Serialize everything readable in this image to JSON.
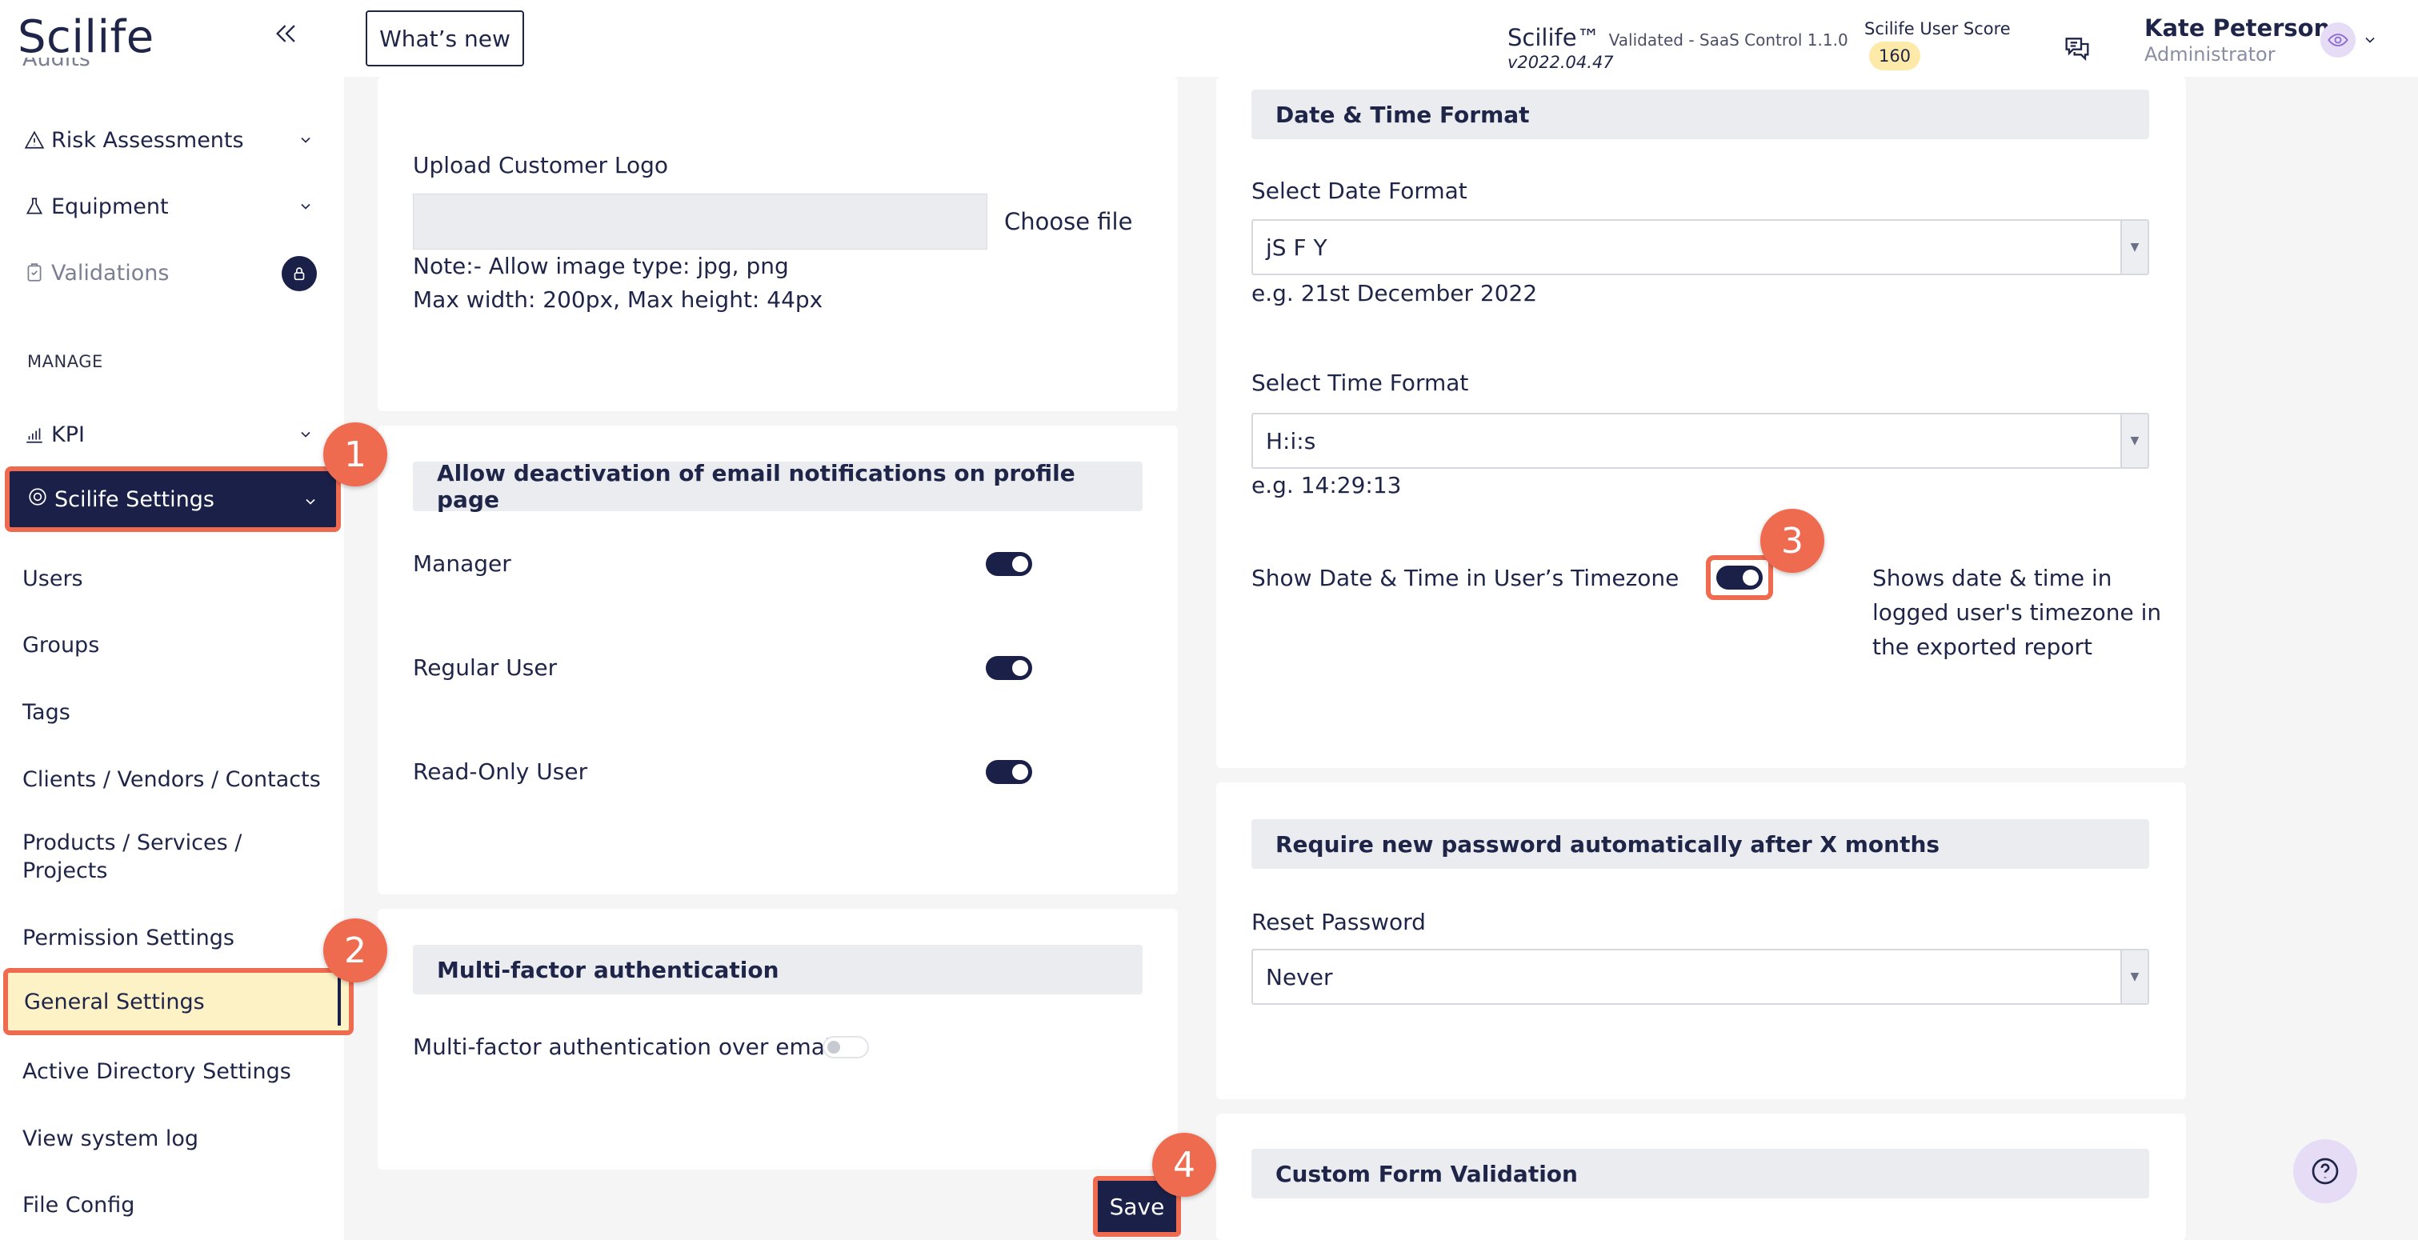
{
  "sidebar": {
    "logo": "Scilife",
    "partial_item": "Audits",
    "items": [
      {
        "label": "Risk Assessments"
      },
      {
        "label": "Equipment"
      },
      {
        "label": "Validations"
      }
    ],
    "section_manage": "MANAGE",
    "kpi": "KPI",
    "settings_group": "Scilife Settings",
    "settings_items": [
      "Users",
      "Groups",
      "Tags",
      "Clients / Vendors / Contacts",
      "Products / Services /",
      "Projects",
      "Permission Settings",
      "General Settings",
      "Active Directory Settings",
      "View system log",
      "File Config"
    ]
  },
  "header": {
    "whats_new": "What’s new",
    "app_name": "Scilife™",
    "app_sub": "Validated - SaaS Control 1.1.0",
    "app_version": "v2022.04.47",
    "score_label": "Scilife User Score",
    "score_value": "160",
    "user_name": "Kate Peterson",
    "user_role": "Administrator"
  },
  "left_col": {
    "upload_label": "Upload Customer Logo",
    "choose_file": "Choose file",
    "note_line1": "Note:- Allow image type: jpg, png",
    "note_line2": "Max width: 200px, Max height: 44px",
    "email_header": "Allow deactivation of email notifications on profile page",
    "email_rows": [
      {
        "label": "Manager",
        "on": true
      },
      {
        "label": "Regular User",
        "on": true
      },
      {
        "label": "Read-Only User",
        "on": true
      }
    ],
    "mfa_header": "Multi-factor authentication",
    "mfa_label": "Multi-factor authentication over email",
    "mfa_on": false
  },
  "right_col": {
    "datetime_header": "Date & Time Format",
    "date_label": "Select Date Format",
    "date_value": "jS F Y",
    "date_example": "e.g. 21st December 2022",
    "time_label": "Select Time Format",
    "time_value": "H:i:s",
    "time_example": "e.g. 14:29:13",
    "tz_label": "Show Date & Time in User’s Timezone",
    "tz_on": true,
    "tz_desc_1": "Shows date & time in",
    "tz_desc_2": "logged user's timezone in",
    "tz_desc_3": "the exported report",
    "password_header": "Require new password automatically after X months",
    "reset_label": "Reset Password",
    "reset_value": "Never",
    "custom_header": "Custom Form Validation"
  },
  "save_label": "Save",
  "markers": [
    "1",
    "2",
    "3",
    "4"
  ],
  "colors": {
    "navy": "#1a2048",
    "highlight": "#ef6b4f",
    "active_bg": "#fdf1c6",
    "panel_header": "#ebecef"
  },
  "icons": [
    "chevrons-left-icon",
    "warning-icon",
    "flask-icon",
    "clipboard-icon",
    "lock-icon",
    "chart-icon",
    "settings-icon",
    "chat-icon",
    "eye-icon",
    "question-icon"
  ]
}
